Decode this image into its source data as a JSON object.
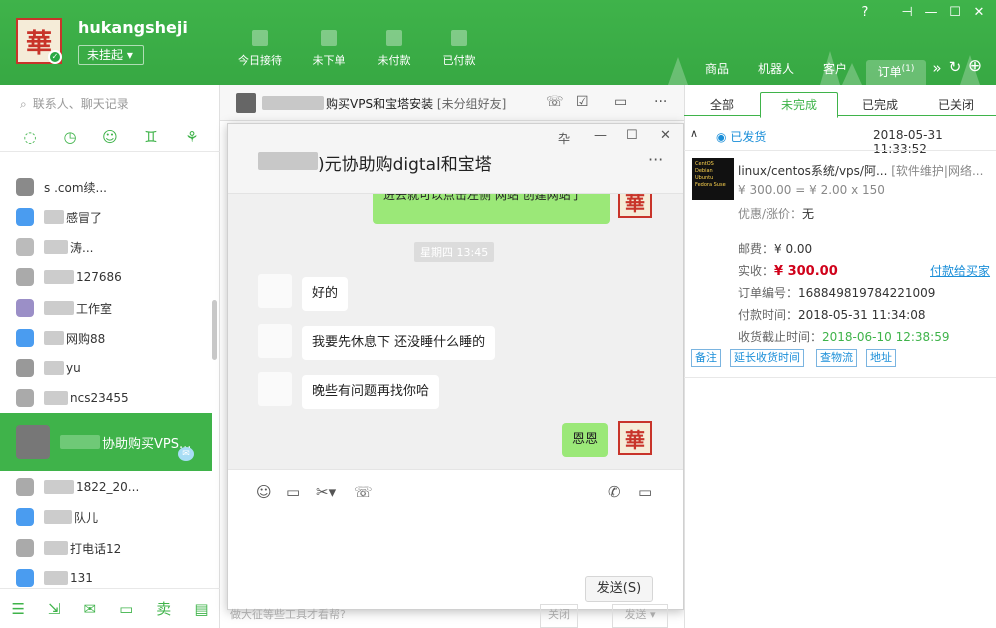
{
  "app": {
    "username": "hukangsheji",
    "status_label": "未挂起",
    "avatar_char": "華"
  },
  "header_stats": [
    {
      "label": "今日接待"
    },
    {
      "label": "未下单"
    },
    {
      "label": "未付款"
    },
    {
      "label": "已付款"
    }
  ],
  "top_nav": {
    "items": [
      "商品",
      "机器人",
      "客户",
      "订单"
    ],
    "order_badge": "(1)"
  },
  "search": {
    "placeholder": "联系人、聊天记录"
  },
  "contacts": [
    {
      "name": "s  .com续...",
      "row": 1
    },
    {
      "name": "感冒了",
      "row": 2
    },
    {
      "name": "涛...",
      "row": 3
    },
    {
      "name": "127686",
      "row": 4
    },
    {
      "name": "工作室",
      "row": 5
    },
    {
      "name": "网购88",
      "row": 6
    },
    {
      "name": "yu",
      "row": 7
    },
    {
      "name": "ncs23455",
      "row": 8
    },
    {
      "name": "协助购买VPS...",
      "row": 9
    },
    {
      "name": "1822_20...",
      "row": 10
    },
    {
      "name": "队儿",
      "row": 11
    },
    {
      "name": "打电话12",
      "row": 12
    },
    {
      "name": "131",
      "row": 13
    }
  ],
  "chat_header": {
    "title": "购买VPS和宝塔安装",
    "group": "[未分组好友]"
  },
  "popup": {
    "title": ")元协助购digtal和宝塔",
    "pin_icon": "卆",
    "more": "···"
  },
  "messages": {
    "partial_out": "进去就可以点击左侧 网站 创建网站了",
    "timestamp": "星期四 13:45",
    "in1": "好的",
    "in2": "我要先休息下 还没睡什么睡的",
    "in3": "晚些有问题再找你哈",
    "out1": "恩恩"
  },
  "send_button": "发送(S)",
  "bottom_hint": "做大征等些工具才看帮?",
  "bottom_btns": [
    "关闭",
    "发送"
  ],
  "orders": {
    "tabs": [
      "全部",
      "未完成",
      "已完成",
      "已关闭"
    ],
    "status": "已发货",
    "datetime": "2018-05-31 11:33:52",
    "product_title": "linux/centos系统/vps/阿...",
    "product_tags": "[软件维护|网络...",
    "price_line": "¥ 300.00 = ¥ 2.00 x 150",
    "discount_label": "优惠/涨价：",
    "discount_value": "无",
    "postage_label": "邮费：",
    "postage_value": "¥ 0.00",
    "paid_label": "实收：",
    "paid_value": "¥ 300.00",
    "pay_link": "付款给买家",
    "order_no_label": "订单编号：",
    "order_no": "168849819784221009",
    "pay_time_label": "付款时间：",
    "pay_time": "2018-05-31 11:34:08",
    "deadline_label": "收货截止时间：",
    "deadline": "2018-06-10 12:38:59",
    "action_btns": [
      "备注",
      "延长收货时间",
      "查物流",
      "地址"
    ],
    "product_img_text": "CentOS Debian Ubuntu Fedora Suse"
  },
  "colors": {
    "brand": "#3fb34a",
    "link": "#1a8ed8",
    "price": "#d0021b",
    "bubble_out": "#9be878"
  }
}
